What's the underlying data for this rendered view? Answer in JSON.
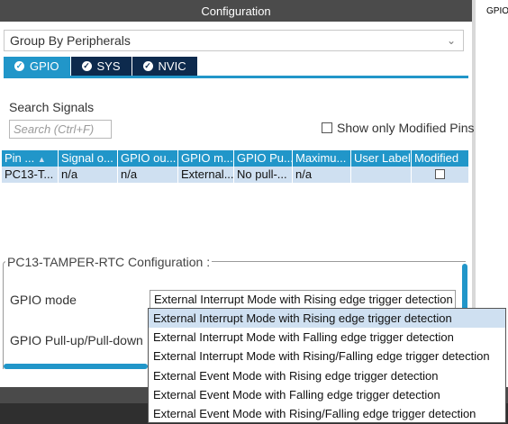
{
  "header": {
    "title": "Configuration",
    "right_panel_label": "GPIO"
  },
  "group_select": {
    "value": "Group By Peripherals",
    "chevron_icon": "chevron-down-icon"
  },
  "tabs": [
    {
      "label": "GPIO",
      "icon": "check-circle-icon",
      "active": true
    },
    {
      "label": "SYS",
      "icon": "check-circle-icon",
      "active": false
    },
    {
      "label": "NVIC",
      "icon": "check-circle-icon",
      "active": false
    }
  ],
  "search": {
    "label": "Search Signals",
    "placeholder": "Search (Ctrl+F)",
    "value": ""
  },
  "show_modified": {
    "label": "Show only Modified Pins",
    "checked": false
  },
  "table": {
    "headers": [
      "Pin ...",
      "Signal o...",
      "GPIO ou...",
      "GPIO m...",
      "GPIO Pu...",
      "Maximu...",
      "User Label",
      "Modified"
    ],
    "sort_icon": "sort-arrows-icon",
    "rows": [
      {
        "cells": [
          "PC13-T...",
          "n/a",
          "n/a",
          "External...",
          "No pull-...",
          "n/a",
          "",
          ""
        ],
        "modified": false
      }
    ]
  },
  "pin_config": {
    "title": "PC13-TAMPER-RTC Configuration :",
    "gpio_mode_label": "GPIO mode",
    "gpio_mode_value": "External Interrupt Mode with Rising edge trigger detection",
    "pull_label": "GPIO Pull-up/Pull-down"
  },
  "dropdown": {
    "options": [
      "External Interrupt Mode with Rising edge trigger detection",
      "External Interrupt Mode with Falling edge trigger detection",
      "External Interrupt Mode with Rising/Falling edge trigger detection",
      "External Event Mode with Rising edge trigger detection",
      "External Event Mode with Falling edge trigger detection",
      "External Event Mode with Rising/Falling edge trigger detection"
    ],
    "selected_index": 0
  },
  "colors": {
    "accent": "#2196c9",
    "tab_dark": "#0d2a4d",
    "row_bg": "#cfe0f1",
    "header_bg": "#4b4b4b"
  }
}
